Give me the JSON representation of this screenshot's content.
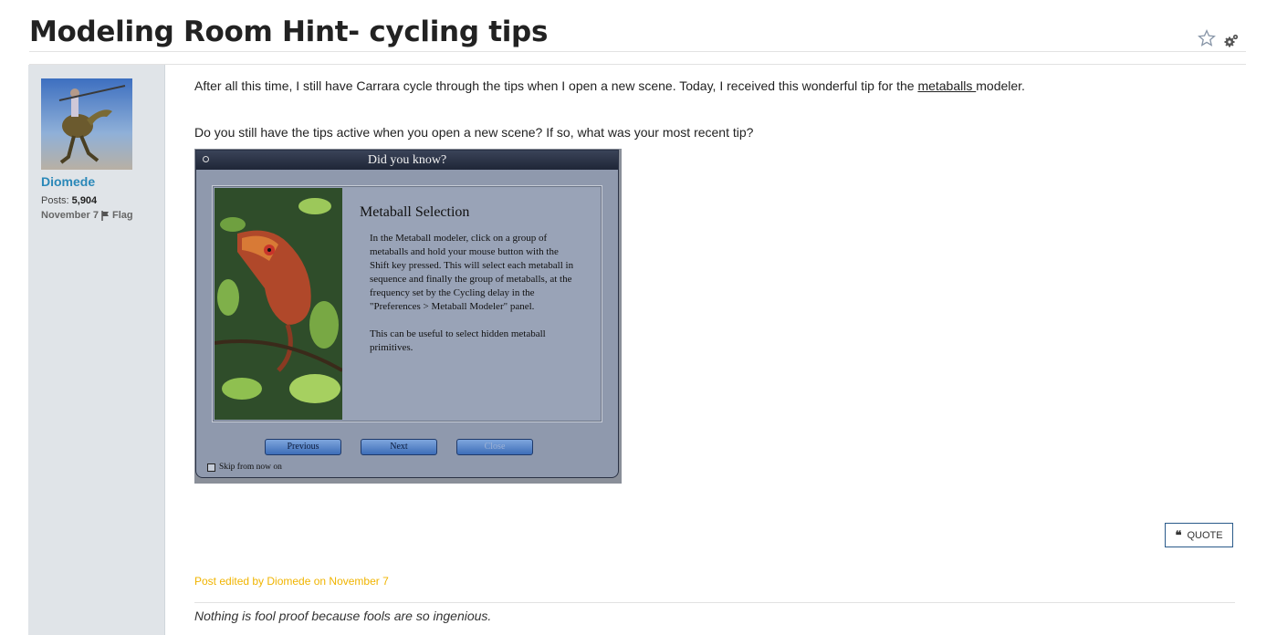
{
  "thread": {
    "title": "Modeling Room Hint- cycling tips",
    "star_icon": "star-outline-icon",
    "options_icon": "gear-icon"
  },
  "author": {
    "name": "Diomede",
    "posts_label": "Posts:",
    "posts_count": "5,904",
    "date": "November 7",
    "flag_label": "Flag"
  },
  "post": {
    "para1_before": "After all this time, I still have Carrara cycle through the tips when I open a new scene.  Today, I received this wonderful tip for the ",
    "para1_link": "metaballs ",
    "para1_after": " modeler.",
    "para2": "Do you still have the tips active when you open a new scene?  If so, what was your most recent tip?",
    "edited": "Post edited by Diomede on November 7",
    "quote_label": "QUOTE",
    "signature": "Nothing is fool proof because fools are so ingenious."
  },
  "dialog": {
    "title": "Did you know?",
    "heading": "Metaball Selection",
    "body1": "In the Metaball modeler, click on a group of metaballs and hold your mouse button with the Shift key pressed. This will select each metaball in sequence and finally the group of metaballs, at the frequency set by the Cycling delay in the \"Preferences > Metaball Modeler\" panel.",
    "body2": "This can be useful to select hidden metaball primitives.",
    "previous": "Previous",
    "next": "Next",
    "close": "Close",
    "skip": "Skip from now on"
  },
  "colors": {
    "username": "#2a88b8",
    "edited": "#f0b400",
    "sidebar": "#e0e4e8"
  }
}
